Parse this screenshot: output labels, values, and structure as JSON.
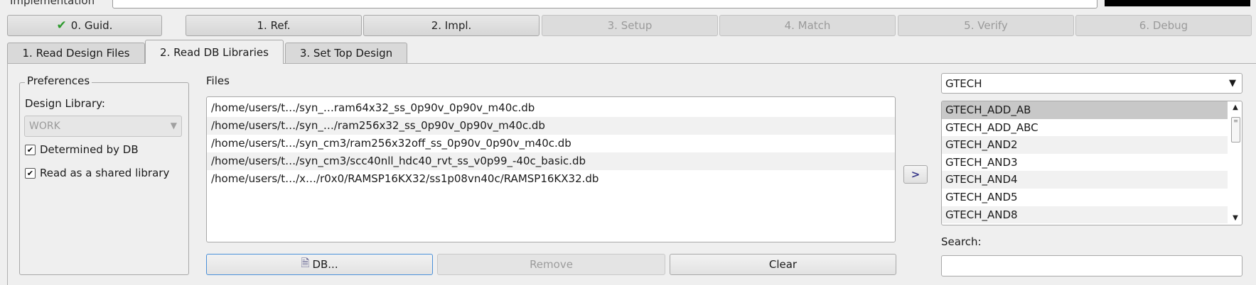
{
  "top": {
    "implementation_label": "Implementation"
  },
  "steps": [
    {
      "label": "0. Guid.",
      "enabled": true,
      "done": true
    },
    {
      "label": "1. Ref.",
      "enabled": true
    },
    {
      "label": "2. Impl.",
      "enabled": true
    },
    {
      "label": "3. Setup",
      "enabled": false
    },
    {
      "label": "4. Match",
      "enabled": false
    },
    {
      "label": "5. Verify",
      "enabled": false
    },
    {
      "label": "6. Debug",
      "enabled": false
    }
  ],
  "tabs": [
    {
      "label": "1. Read Design Files"
    },
    {
      "label": "2. Read DB Libraries",
      "active": true
    },
    {
      "label": "3. Set Top Design"
    }
  ],
  "preferences": {
    "title": "Preferences",
    "design_library_label": "Design Library:",
    "design_library_value": "WORK",
    "determined_by_db": {
      "label": "Determined by DB",
      "checked": true
    },
    "read_as_shared": {
      "label": "Read as a shared library",
      "checked": true
    }
  },
  "files": {
    "label": "Files",
    "items": [
      "/home/users/t…/syn_…ram64x32_ss_0p90v_0p90v_m40c.db",
      "/home/users/t…/syn_…/ram256x32_ss_0p90v_0p90v_m40c.db",
      "/home/users/t…/syn_cm3/ram256x32off_ss_0p90v_0p90v_m40c.db",
      "/home/users/t…/syn_cm3/scc40nll_hdc40_rvt_ss_v0p99_-40c_basic.db",
      "/home/users/t…/x…/r0x0/RAMSP16KX32/ss1p08vn40c/RAMSP16KX32.db"
    ]
  },
  "buttons": {
    "db": "DB...",
    "remove": "Remove",
    "clear": "Clear"
  },
  "icons": {
    "check": "check-icon",
    "db": "database-file-icon",
    "transfer": "chevron-right-icon"
  },
  "library": {
    "selected": "GTECH",
    "cells": [
      "GTECH_ADD_AB",
      "GTECH_ADD_ABC",
      "GTECH_AND2",
      "GTECH_AND3",
      "GTECH_AND4",
      "GTECH_AND5",
      "GTECH_AND8"
    ],
    "selected_index": 0
  },
  "search": {
    "label": "Search:",
    "value": ""
  },
  "colors": {
    "accent_focus": "#4a90d9",
    "check_green": "#2e9a2e"
  }
}
